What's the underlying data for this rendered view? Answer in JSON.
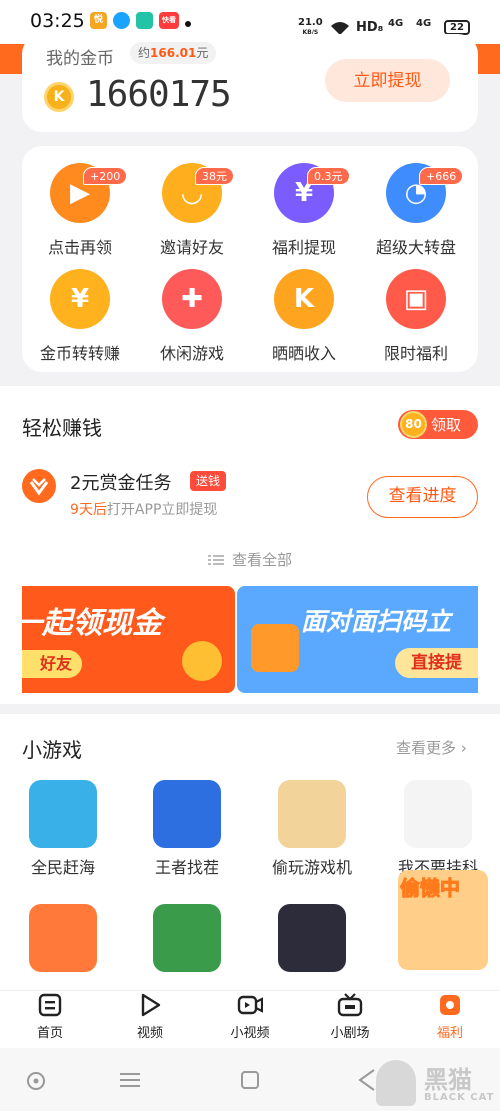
{
  "status_bar": {
    "time": "03:25",
    "app_badges": [
      "悦",
      "",
      "",
      "快看"
    ],
    "net_speed": "21.0",
    "net_unit": "KB/S",
    "hd": "HD₈",
    "signal_1": "4G",
    "signal_2": "4G",
    "battery": "22"
  },
  "coins": {
    "label": "我的金币",
    "approx_prefix": "约",
    "approx_value": "166.01",
    "approx_unit": "元",
    "amount": "1660175",
    "coin_symbol": "K",
    "withdraw_button": "立即提现"
  },
  "grid": [
    {
      "label": "点击再领",
      "tag": "+200",
      "icon": "video-card-icon",
      "color": "#ff8a1e"
    },
    {
      "label": "邀请好友",
      "tag": "38元",
      "icon": "smile-face-icon",
      "color": "#ffae1e"
    },
    {
      "label": "福利提现",
      "tag": "0.3元",
      "icon": "yen-wallet-icon",
      "color": "#7b5cff"
    },
    {
      "label": "超级大转盘",
      "tag": "+666",
      "icon": "spin-wheel-icon",
      "color": "#3f8cff"
    },
    {
      "label": "金币转转赚",
      "tag": "",
      "icon": "money-bag-icon",
      "color": "#ffb11e"
    },
    {
      "label": "休闲游戏",
      "tag": "",
      "icon": "gamepad-icon",
      "color": "#ff5a5a"
    },
    {
      "label": "晒晒收入",
      "tag": "",
      "icon": "k-coin-icon",
      "color": "#ffa41e"
    },
    {
      "label": "限时福利",
      "tag": "",
      "icon": "gift-box-icon",
      "color": "#ff5a4a"
    }
  ],
  "earn": {
    "title": "轻松赚钱",
    "claim_coins": "80",
    "claim_label": "领取",
    "task_title": "2元赏金任务",
    "task_tag": "送钱",
    "task_days": "9天后",
    "task_desc": "打开APP立即提现",
    "progress_button": "查看进度",
    "view_all": "查看全部",
    "banner_1_title": "一起领现金",
    "banner_1_button": "好友",
    "banner_2_title": "面对面扫码立",
    "banner_2_button": "直接提"
  },
  "games": {
    "title": "小游戏",
    "see_more": "查看更多",
    "items": [
      {
        "name": "全民赶海",
        "color": "#3ab0e8"
      },
      {
        "name": "王者找茬",
        "color": "#2d6fe0"
      },
      {
        "name": "偷玩游戏机",
        "color": "#f2d39a"
      },
      {
        "name": "我不要挂科",
        "color": "#f4f4f4"
      },
      {
        "name": "",
        "color": "#ff7a3a"
      },
      {
        "name": "",
        "color": "#3a9c4a"
      },
      {
        "name": "",
        "color": "#2c2c3a"
      }
    ],
    "float_label": "偷懒中"
  },
  "tabs": [
    {
      "label": "首页",
      "icon": "home-icon"
    },
    {
      "label": "视频",
      "icon": "play-icon"
    },
    {
      "label": "小视频",
      "icon": "short-video-icon"
    },
    {
      "label": "小剧场",
      "icon": "tv-icon"
    },
    {
      "label": "福利",
      "icon": "welfare-icon",
      "active": true
    }
  ],
  "watermark": {
    "cn": "黑猫",
    "en": "BLACK CAT"
  }
}
